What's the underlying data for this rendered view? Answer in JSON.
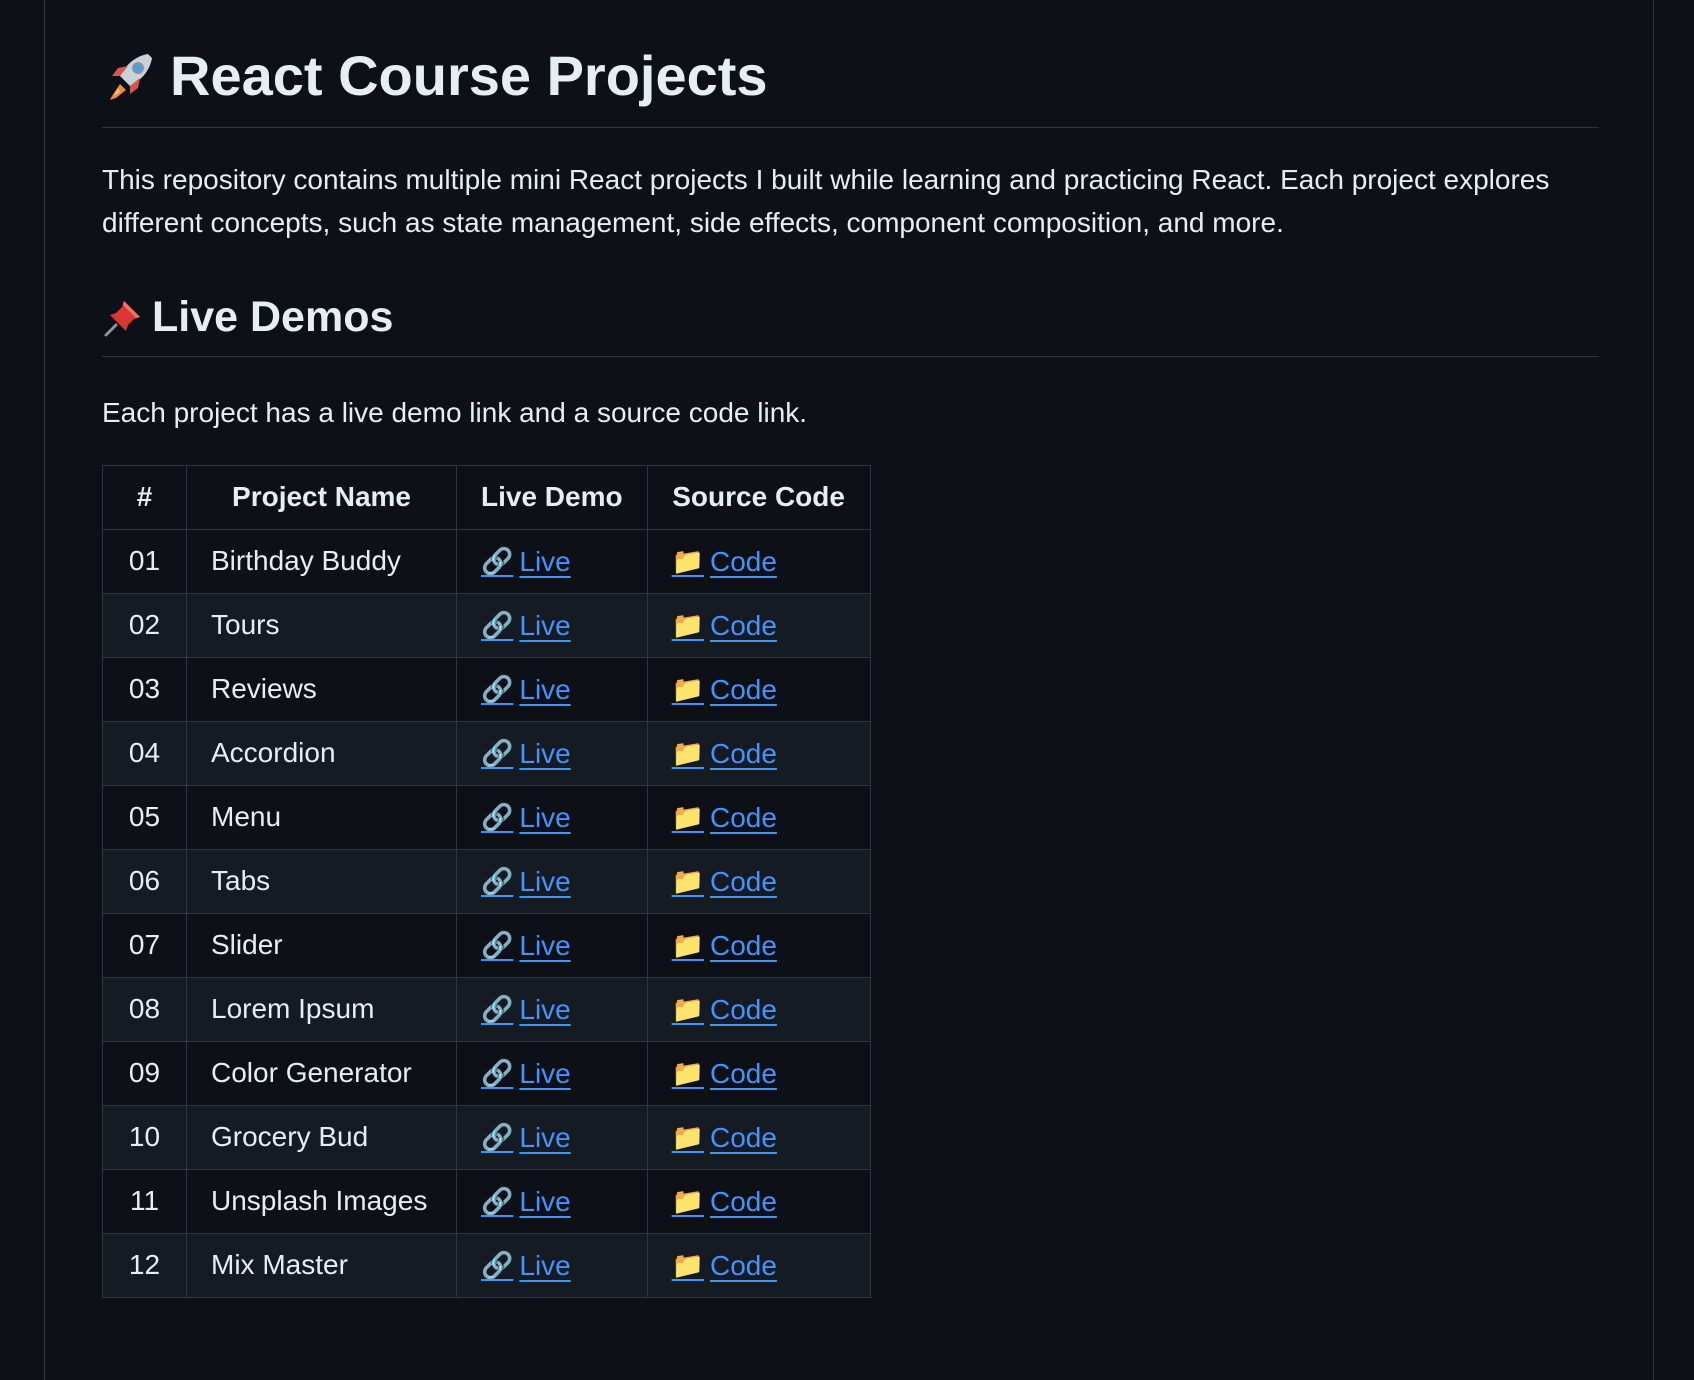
{
  "header": {
    "icon": "rocket-icon",
    "title": "React Course Projects"
  },
  "intro": {
    "text": "This repository contains multiple mini React projects I built while learning and practicing React. Each project explores different concepts, such as state management, side effects, component composition, and more."
  },
  "demos": {
    "icon": "pushpin-icon",
    "heading": "Live Demos",
    "subtext": "Each project has a live demo link and a source code link."
  },
  "table": {
    "headers": [
      "#",
      "Project Name",
      "Live Demo",
      "Source Code"
    ],
    "live_label": "Live",
    "code_label": "Code",
    "live_icon": "link-icon",
    "code_icon": "folder-icon",
    "rows": [
      {
        "num": "01",
        "name": "Birthday Buddy"
      },
      {
        "num": "02",
        "name": "Tours"
      },
      {
        "num": "03",
        "name": "Reviews"
      },
      {
        "num": "04",
        "name": "Accordion"
      },
      {
        "num": "05",
        "name": "Menu"
      },
      {
        "num": "06",
        "name": "Tabs"
      },
      {
        "num": "07",
        "name": "Slider"
      },
      {
        "num": "08",
        "name": "Lorem Ipsum"
      },
      {
        "num": "09",
        "name": "Color Generator"
      },
      {
        "num": "10",
        "name": "Grocery Bud"
      },
      {
        "num": "11",
        "name": "Unsplash Images"
      },
      {
        "num": "12",
        "name": "Mix Master"
      }
    ]
  },
  "colors": {
    "background": "#0d1117",
    "text": "#e6edf3",
    "link": "#4493f8",
    "border": "#30363d",
    "stripe": "#151b23"
  }
}
